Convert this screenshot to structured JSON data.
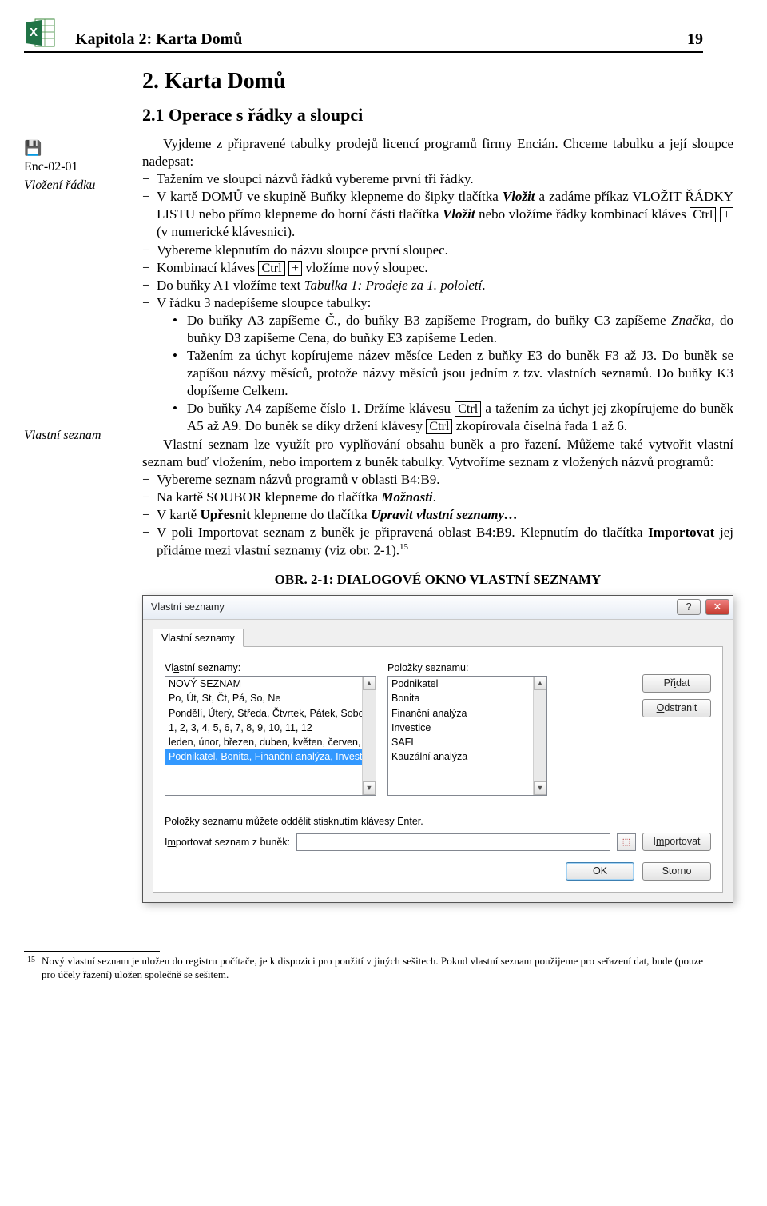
{
  "header": {
    "chapter": "Kapitola 2: Karta Domů",
    "page": "19"
  },
  "side": {
    "floppy": "💾",
    "enc": "Enc-02-01",
    "vlozeni": "Vložení řádku",
    "vlastni": "Vlastní seznam"
  },
  "h2": "2. Karta Domů",
  "h3": "2.1 Operace s řádky a sloupci",
  "para1a": "Vyjdeme z připravené tabulky prodejů licencí programů firmy Encián. Chceme tabulku a její sloupce nadepsat:",
  "li1": "Tažením ve sloupci názvů řádků vybereme první tři řádky.",
  "li2a": "V kartě D",
  "li2b": "OMŮ",
  "li2c": " ve skupině Buňky klepneme do šipky tlačítka ",
  "li2d": "Vložit",
  "li2e": " a zadáme příkaz V",
  "li2f": "LOŽIT ŘÁDKY LISTU",
  "li2g": " nebo přímo klepneme do horní části tlačítka ",
  "li2h": "Vložit",
  "li2i": " nebo vložíme řádky kombinací kláves ",
  "li2j": "Ctrl",
  "li2k": "+",
  "li2l": " (v numerické klávesnici).",
  "li3": "Vybereme klepnutím do názvu sloupce první sloupec.",
  "li4a": "Kombinací kláves ",
  "li4b": "Ctrl",
  "li4c": "+",
  "li4d": " vložíme nový sloupec.",
  "li5a": "Do buňky A1 vložíme text ",
  "li5b": "Tabulka 1: Prodeje za 1. pololetí",
  "li5c": ".",
  "li6": "V řádku 3 nadepíšeme sloupce tabulky:",
  "b1a": "Do buňky A3 zapíšeme ",
  "b1b": "Č.",
  "b1c": ", do buňky B3 zapíšeme Program, do buňky C3 zapíšeme ",
  "b1d": "Značka",
  "b1e": ", do buňky D3 zapíšeme Cena, do buňky E3 zapíšeme Leden.",
  "b2": "Tažením za úchyt kopírujeme název měsíce Leden z buňky E3 do buněk F3 až J3. Do buněk se zapíšou názvy měsíců, protože názvy měsíců jsou jedním z tzv. vlastních seznamů. Do buňky K3 dopíšeme Celkem.",
  "b3a": "Do buňky A4 zapíšeme číslo 1. Držíme klávesu ",
  "b3b": "Ctrl",
  "b3c": " a tažením za úchyt jej zkopírujeme do buněk A5 až A9. Do buněk se díky držení klávesy ",
  "b3d": "Ctrl",
  "b3e": " zkopírovala číselná řada 1 až 6.",
  "para2": "Vlastní seznam lze využít pro vyplňování obsahu buněk a pro řazení. Můžeme také vytvořit vlastní seznam buď vložením, nebo importem z buněk tabulky. Vytvoříme seznam z vložených názvů programů:",
  "li7": "Vybereme seznam názvů programů v oblasti B4:B9.",
  "li8a": "Na kartě S",
  "li8b": "OUBOR",
  "li8c": " klepneme do tlačítka ",
  "li8d": "Možnosti",
  "li8e": ".",
  "li9a": "V kartě ",
  "li9b": "Upřesnit",
  "li9c": " klepneme do tlačítka ",
  "li9d": "Upravit vlastní seznamy…",
  "li10a": "V poli Importovat seznam z buněk je připravená oblast B4:B9. Klepnutím do tlačítka ",
  "li10b": "Importovat",
  "li10c": " jej přidáme mezi vlastní seznamy (viz obr. 2-1).",
  "fnref": "15",
  "figcap": "OBR. 2-1: DIALOGOVÉ OKNO VLASTNÍ SEZNAMY",
  "dialog": {
    "title": "Vlastní seznamy",
    "help_glyph": "?",
    "close_glyph": "✕",
    "tab": "Vlastní seznamy",
    "label_left": "Vl_astní seznamy:",
    "label_right": "Položky seznamu:",
    "list_left": [
      "NOVÝ SEZNAM",
      "Po, Út, St, Čt, Pá, So, Ne",
      "Pondělí, Úterý, Středa, Čtvrtek, Pátek, Sobot",
      "1, 2, 3, 4, 5, 6, 7, 8, 9, 10, 11, 12",
      "leden, únor, březen, duben, květen, červen,",
      "Podnikatel, Bonita, Finanční analýza, Investic"
    ],
    "list_right": [
      "Podnikatel",
      "Bonita",
      "Finanční analýza",
      "Investice",
      "SAFI",
      "Kauzální analýza"
    ],
    "btn_add": "Př_idat",
    "btn_del": "_Odstranit",
    "hint": "Položky seznamu můžete oddělit stisknutím klávesy Enter.",
    "label_import": "I_mportovat seznam z buněk:",
    "range_icon": "⬚",
    "btn_import": "I_mportovat",
    "btn_ok": "OK",
    "btn_cancel": "Storno"
  },
  "footnote": {
    "num": "15",
    "text": "Nový vlastní seznam je uložen do registru počítače, je k dispozici pro použití v jiných sešitech. Pokud vlastní seznam použijeme pro seřazení dat, bude (pouze pro účely řazení) uložen společně se sešitem."
  }
}
